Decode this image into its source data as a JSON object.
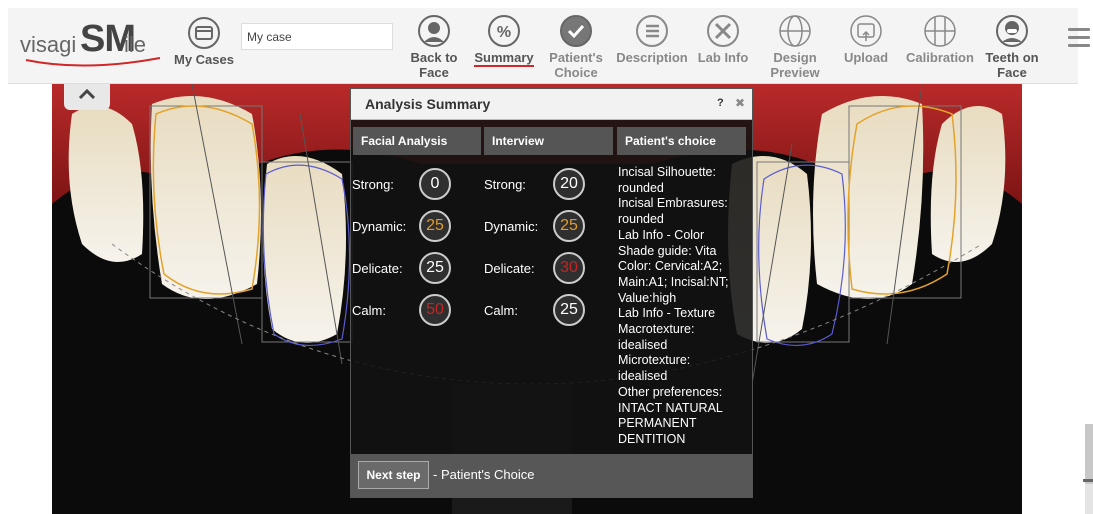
{
  "logo": {
    "part1": "visagi",
    "part2": "SM",
    "part3": "ile"
  },
  "toolbar": {
    "my_cases": "My Cases",
    "case_input_value": "My case",
    "back_to_face_l1": "Back to",
    "back_to_face_l2": "Face",
    "summary": "Summary",
    "patients_choice_l1": "Patient's",
    "patients_choice_l2": "Choice",
    "description": "Description",
    "lab_info": "Lab Info",
    "design_preview_l1": "Design",
    "design_preview_l2": "Preview",
    "upload": "Upload",
    "calibration": "Calibration",
    "teeth_on_face_l1": "Teeth on",
    "teeth_on_face_l2": "Face"
  },
  "dialog": {
    "title": "Analysis Summary",
    "help": "?",
    "close": "✖",
    "columns": {
      "facial": "Facial Analysis",
      "interview": "Interview",
      "choice": "Patient's choice"
    },
    "facial": {
      "strong_label": "Strong:",
      "strong": "0",
      "dynamic_label": "Dynamic:",
      "dynamic": "25",
      "delicate_label": "Delicate:",
      "delicate": "25",
      "calm_label": "Calm:",
      "calm": "50"
    },
    "interview": {
      "strong_label": "Strong:",
      "strong": "20",
      "dynamic_label": "Dynamic:",
      "dynamic": "25",
      "delicate_label": "Delicate:",
      "delicate": "30",
      "calm_label": "Calm:",
      "calm": "25"
    },
    "choice_lines": [
      "Incisal Silhouette:",
      "rounded",
      "Incisal Embrasures:",
      "rounded",
      "Lab Info - Color",
      "Shade guide: Vita",
      "Color: Cervical:A2;",
      "Main:A1; Incisal:NT;",
      "Value:high",
      "Lab Info - Texture",
      "Macrotexture:",
      "idealised",
      "Microtexture:",
      "idealised",
      "Other preferences:",
      "INTACT NATURAL",
      "PERMANENT",
      "DENTITION"
    ],
    "next_step": "Next step",
    "footer_text": "- Patient's Choice"
  },
  "colors": {
    "accent_red": "#d02828",
    "score_orange": "#e39a2a",
    "score_red": "#c62323",
    "toolbar_bg": "#f4f4f4"
  }
}
